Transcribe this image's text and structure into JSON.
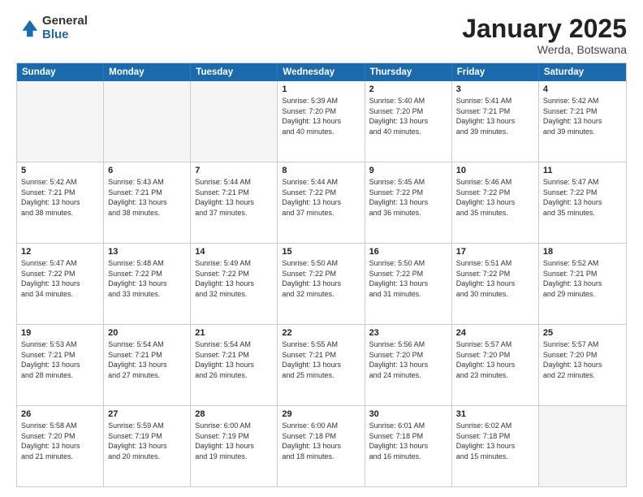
{
  "logo": {
    "general": "General",
    "blue": "Blue"
  },
  "title": "January 2025",
  "location": "Werda, Botswana",
  "days": [
    "Sunday",
    "Monday",
    "Tuesday",
    "Wednesday",
    "Thursday",
    "Friday",
    "Saturday"
  ],
  "weeks": [
    [
      {
        "day": "",
        "text": "",
        "empty": true
      },
      {
        "day": "",
        "text": "",
        "empty": true
      },
      {
        "day": "",
        "text": "",
        "empty": true
      },
      {
        "day": "1",
        "text": "Sunrise: 5:39 AM\nSunset: 7:20 PM\nDaylight: 13 hours\nand 40 minutes.",
        "empty": false
      },
      {
        "day": "2",
        "text": "Sunrise: 5:40 AM\nSunset: 7:20 PM\nDaylight: 13 hours\nand 40 minutes.",
        "empty": false
      },
      {
        "day": "3",
        "text": "Sunrise: 5:41 AM\nSunset: 7:21 PM\nDaylight: 13 hours\nand 39 minutes.",
        "empty": false
      },
      {
        "day": "4",
        "text": "Sunrise: 5:42 AM\nSunset: 7:21 PM\nDaylight: 13 hours\nand 39 minutes.",
        "empty": false
      }
    ],
    [
      {
        "day": "5",
        "text": "Sunrise: 5:42 AM\nSunset: 7:21 PM\nDaylight: 13 hours\nand 38 minutes.",
        "empty": false
      },
      {
        "day": "6",
        "text": "Sunrise: 5:43 AM\nSunset: 7:21 PM\nDaylight: 13 hours\nand 38 minutes.",
        "empty": false
      },
      {
        "day": "7",
        "text": "Sunrise: 5:44 AM\nSunset: 7:21 PM\nDaylight: 13 hours\nand 37 minutes.",
        "empty": false
      },
      {
        "day": "8",
        "text": "Sunrise: 5:44 AM\nSunset: 7:22 PM\nDaylight: 13 hours\nand 37 minutes.",
        "empty": false
      },
      {
        "day": "9",
        "text": "Sunrise: 5:45 AM\nSunset: 7:22 PM\nDaylight: 13 hours\nand 36 minutes.",
        "empty": false
      },
      {
        "day": "10",
        "text": "Sunrise: 5:46 AM\nSunset: 7:22 PM\nDaylight: 13 hours\nand 35 minutes.",
        "empty": false
      },
      {
        "day": "11",
        "text": "Sunrise: 5:47 AM\nSunset: 7:22 PM\nDaylight: 13 hours\nand 35 minutes.",
        "empty": false
      }
    ],
    [
      {
        "day": "12",
        "text": "Sunrise: 5:47 AM\nSunset: 7:22 PM\nDaylight: 13 hours\nand 34 minutes.",
        "empty": false
      },
      {
        "day": "13",
        "text": "Sunrise: 5:48 AM\nSunset: 7:22 PM\nDaylight: 13 hours\nand 33 minutes.",
        "empty": false
      },
      {
        "day": "14",
        "text": "Sunrise: 5:49 AM\nSunset: 7:22 PM\nDaylight: 13 hours\nand 32 minutes.",
        "empty": false
      },
      {
        "day": "15",
        "text": "Sunrise: 5:50 AM\nSunset: 7:22 PM\nDaylight: 13 hours\nand 32 minutes.",
        "empty": false
      },
      {
        "day": "16",
        "text": "Sunrise: 5:50 AM\nSunset: 7:22 PM\nDaylight: 13 hours\nand 31 minutes.",
        "empty": false
      },
      {
        "day": "17",
        "text": "Sunrise: 5:51 AM\nSunset: 7:22 PM\nDaylight: 13 hours\nand 30 minutes.",
        "empty": false
      },
      {
        "day": "18",
        "text": "Sunrise: 5:52 AM\nSunset: 7:21 PM\nDaylight: 13 hours\nand 29 minutes.",
        "empty": false
      }
    ],
    [
      {
        "day": "19",
        "text": "Sunrise: 5:53 AM\nSunset: 7:21 PM\nDaylight: 13 hours\nand 28 minutes.",
        "empty": false
      },
      {
        "day": "20",
        "text": "Sunrise: 5:54 AM\nSunset: 7:21 PM\nDaylight: 13 hours\nand 27 minutes.",
        "empty": false
      },
      {
        "day": "21",
        "text": "Sunrise: 5:54 AM\nSunset: 7:21 PM\nDaylight: 13 hours\nand 26 minutes.",
        "empty": false
      },
      {
        "day": "22",
        "text": "Sunrise: 5:55 AM\nSunset: 7:21 PM\nDaylight: 13 hours\nand 25 minutes.",
        "empty": false
      },
      {
        "day": "23",
        "text": "Sunrise: 5:56 AM\nSunset: 7:20 PM\nDaylight: 13 hours\nand 24 minutes.",
        "empty": false
      },
      {
        "day": "24",
        "text": "Sunrise: 5:57 AM\nSunset: 7:20 PM\nDaylight: 13 hours\nand 23 minutes.",
        "empty": false
      },
      {
        "day": "25",
        "text": "Sunrise: 5:57 AM\nSunset: 7:20 PM\nDaylight: 13 hours\nand 22 minutes.",
        "empty": false
      }
    ],
    [
      {
        "day": "26",
        "text": "Sunrise: 5:58 AM\nSunset: 7:20 PM\nDaylight: 13 hours\nand 21 minutes.",
        "empty": false
      },
      {
        "day": "27",
        "text": "Sunrise: 5:59 AM\nSunset: 7:19 PM\nDaylight: 13 hours\nand 20 minutes.",
        "empty": false
      },
      {
        "day": "28",
        "text": "Sunrise: 6:00 AM\nSunset: 7:19 PM\nDaylight: 13 hours\nand 19 minutes.",
        "empty": false
      },
      {
        "day": "29",
        "text": "Sunrise: 6:00 AM\nSunset: 7:18 PM\nDaylight: 13 hours\nand 18 minutes.",
        "empty": false
      },
      {
        "day": "30",
        "text": "Sunrise: 6:01 AM\nSunset: 7:18 PM\nDaylight: 13 hours\nand 16 minutes.",
        "empty": false
      },
      {
        "day": "31",
        "text": "Sunrise: 6:02 AM\nSunset: 7:18 PM\nDaylight: 13 hours\nand 15 minutes.",
        "empty": false
      },
      {
        "day": "",
        "text": "",
        "empty": true
      }
    ]
  ]
}
